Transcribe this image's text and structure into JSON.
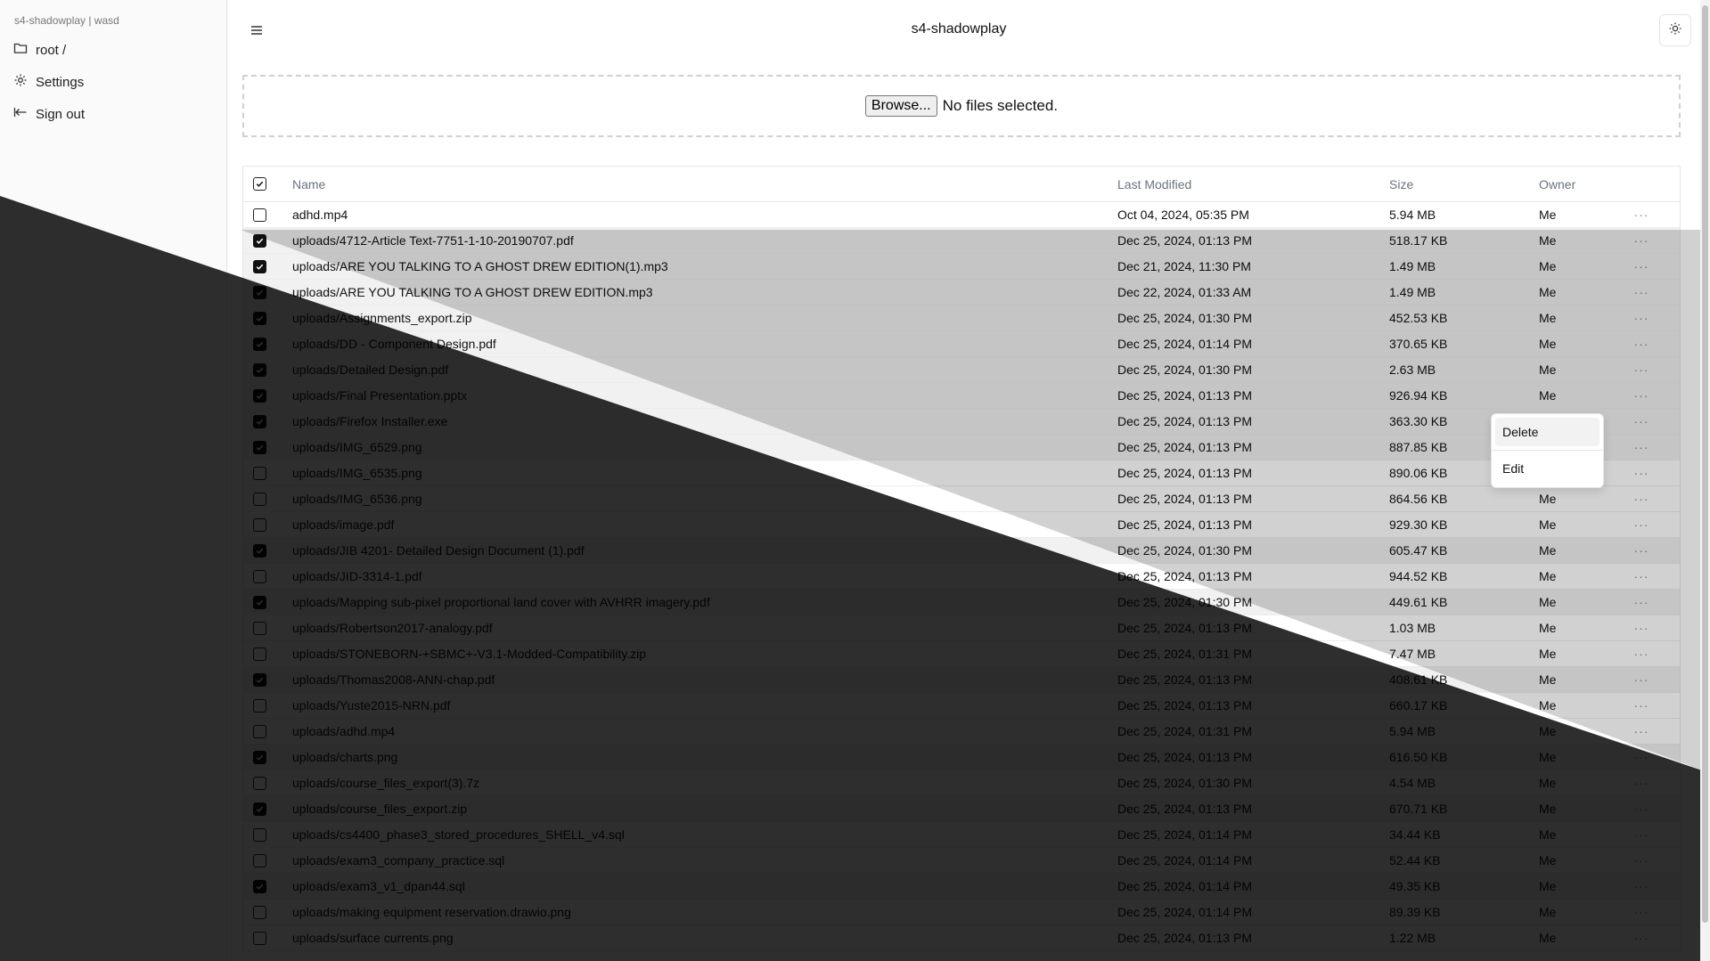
{
  "sidebar": {
    "workspace": "s4-shadowplay | wasd",
    "items": [
      {
        "label": "root /",
        "icon": "folder-icon"
      },
      {
        "label": "Settings",
        "icon": "gear-icon"
      },
      {
        "label": "Sign out",
        "icon": "sign-out-icon"
      }
    ]
  },
  "header": {
    "title": "s4-shadowplay",
    "menu_icon": "hamburger-menu-icon",
    "theme_icon": "sun-icon"
  },
  "upload": {
    "browse_label": "Browse...",
    "status": "No files selected."
  },
  "table": {
    "columns": {
      "name": "Name",
      "modified": "Last Modified",
      "size": "Size",
      "owner": "Owner"
    },
    "action_label": "···",
    "rows": [
      {
        "name": "adhd.mp4",
        "modified": "Oct 04, 2024, 05:35 PM",
        "size": "5.94 MB",
        "owner": "Me",
        "checked": false
      },
      {
        "name": "uploads/4712-Article Text-7751-1-10-20190707.pdf",
        "modified": "Dec 25, 2024, 01:13 PM",
        "size": "518.17 KB",
        "owner": "Me",
        "checked": true
      },
      {
        "name": "uploads/ARE YOU TALKING TO A GHOST DREW EDITION(1).mp3",
        "modified": "Dec 21, 2024, 11:30 PM",
        "size": "1.49 MB",
        "owner": "Me",
        "checked": true
      },
      {
        "name": "uploads/ARE YOU TALKING TO A GHOST DREW EDITION.mp3",
        "modified": "Dec 22, 2024, 01:33 AM",
        "size": "1.49 MB",
        "owner": "Me",
        "checked": true
      },
      {
        "name": "uploads/Assignments_export.zip",
        "modified": "Dec 25, 2024, 01:30 PM",
        "size": "452.53 KB",
        "owner": "Me",
        "checked": true
      },
      {
        "name": "uploads/DD - Component Design.pdf",
        "modified": "Dec 25, 2024, 01:14 PM",
        "size": "370.65 KB",
        "owner": "Me",
        "checked": true
      },
      {
        "name": "uploads/Detailed Design.pdf",
        "modified": "Dec 25, 2024, 01:30 PM",
        "size": "2.63 MB",
        "owner": "Me",
        "checked": true
      },
      {
        "name": "uploads/Final Presentation.pptx",
        "modified": "Dec 25, 2024, 01:13 PM",
        "size": "926.94 KB",
        "owner": "Me",
        "checked": true
      },
      {
        "name": "uploads/Firefox Installer.exe",
        "modified": "Dec 25, 2024, 01:13 PM",
        "size": "363.30 KB",
        "owner": "Me",
        "checked": true
      },
      {
        "name": "uploads/IMG_6529.png",
        "modified": "Dec 25, 2024, 01:13 PM",
        "size": "887.85 KB",
        "owner": "Me",
        "checked": true
      },
      {
        "name": "uploads/IMG_6535.png",
        "modified": "Dec 25, 2024, 01:13 PM",
        "size": "890.06 KB",
        "owner": "Me",
        "checked": false
      },
      {
        "name": "uploads/IMG_6536.png",
        "modified": "Dec 25, 2024, 01:13 PM",
        "size": "864.56 KB",
        "owner": "Me",
        "checked": false
      },
      {
        "name": "uploads/image.pdf",
        "modified": "Dec 25, 2024, 01:13 PM",
        "size": "929.30 KB",
        "owner": "Me",
        "checked": false
      },
      {
        "name": "uploads/JIB 4201- Detailed Design Document (1).pdf",
        "modified": "Dec 25, 2024, 01:30 PM",
        "size": "605.47 KB",
        "owner": "Me",
        "checked": true
      },
      {
        "name": "uploads/JID-3314-1.pdf",
        "modified": "Dec 25, 2024, 01:13 PM",
        "size": "944.52 KB",
        "owner": "Me",
        "checked": false
      },
      {
        "name": "uploads/Mapping sub-pixel proportional land cover with AVHRR imagery.pdf",
        "modified": "Dec 25, 2024, 01:30 PM",
        "size": "449.61 KB",
        "owner": "Me",
        "checked": true
      },
      {
        "name": "uploads/Robertson2017-analogy.pdf",
        "modified": "Dec 25, 2024, 01:13 PM",
        "size": "1.03 MB",
        "owner": "Me",
        "checked": false
      },
      {
        "name": "uploads/STONEBORN-+SBMC+-V3.1-Modded-Compatibility.zip",
        "modified": "Dec 25, 2024, 01:31 PM",
        "size": "7.47 MB",
        "owner": "Me",
        "checked": false
      },
      {
        "name": "uploads/Thomas2008-ANN-chap.pdf",
        "modified": "Dec 25, 2024, 01:13 PM",
        "size": "408.61 KB",
        "owner": "Me",
        "checked": true
      },
      {
        "name": "uploads/Yuste2015-NRN.pdf",
        "modified": "Dec 25, 2024, 01:13 PM",
        "size": "660.17 KB",
        "owner": "Me",
        "checked": false
      },
      {
        "name": "uploads/adhd.mp4",
        "modified": "Dec 25, 2024, 01:31 PM",
        "size": "5.94 MB",
        "owner": "Me",
        "checked": false
      },
      {
        "name": "uploads/charts.png",
        "modified": "Dec 25, 2024, 01:13 PM",
        "size": "616.50 KB",
        "owner": "Me",
        "checked": true
      },
      {
        "name": "uploads/course_files_export(3).7z",
        "modified": "Dec 25, 2024, 01:30 PM",
        "size": "4.54 MB",
        "owner": "Me",
        "checked": false
      },
      {
        "name": "uploads/course_files_export.zip",
        "modified": "Dec 25, 2024, 01:13 PM",
        "size": "670.71 KB",
        "owner": "Me",
        "checked": true
      },
      {
        "name": "uploads/cs4400_phase3_stored_procedures_SHELL_v4.sql",
        "modified": "Dec 25, 2024, 01:14 PM",
        "size": "34.44 KB",
        "owner": "Me",
        "checked": false
      },
      {
        "name": "uploads/exam3_company_practice.sql",
        "modified": "Dec 25, 2024, 01:14 PM",
        "size": "52.44 KB",
        "owner": "Me",
        "checked": false
      },
      {
        "name": "uploads/exam3_v1_dpan44.sql",
        "modified": "Dec 25, 2024, 01:14 PM",
        "size": "49.35 KB",
        "owner": "Me",
        "checked": true
      },
      {
        "name": "uploads/making equipment reservation.drawio.png",
        "modified": "Dec 25, 2024, 01:14 PM",
        "size": "89.39 KB",
        "owner": "Me",
        "checked": false
      },
      {
        "name": "uploads/surface currents.png",
        "modified": "Dec 25, 2024, 01:13 PM",
        "size": "1.22 MB",
        "owner": "Me",
        "checked": false
      }
    ]
  },
  "context_menu": {
    "delete_label": "Delete",
    "edit_label": "Edit"
  },
  "colors": {
    "selected_row": "#f1f1f1",
    "overlay_dim": "rgba(0,0,0,0.4)",
    "overlay_dark": "#000000"
  }
}
